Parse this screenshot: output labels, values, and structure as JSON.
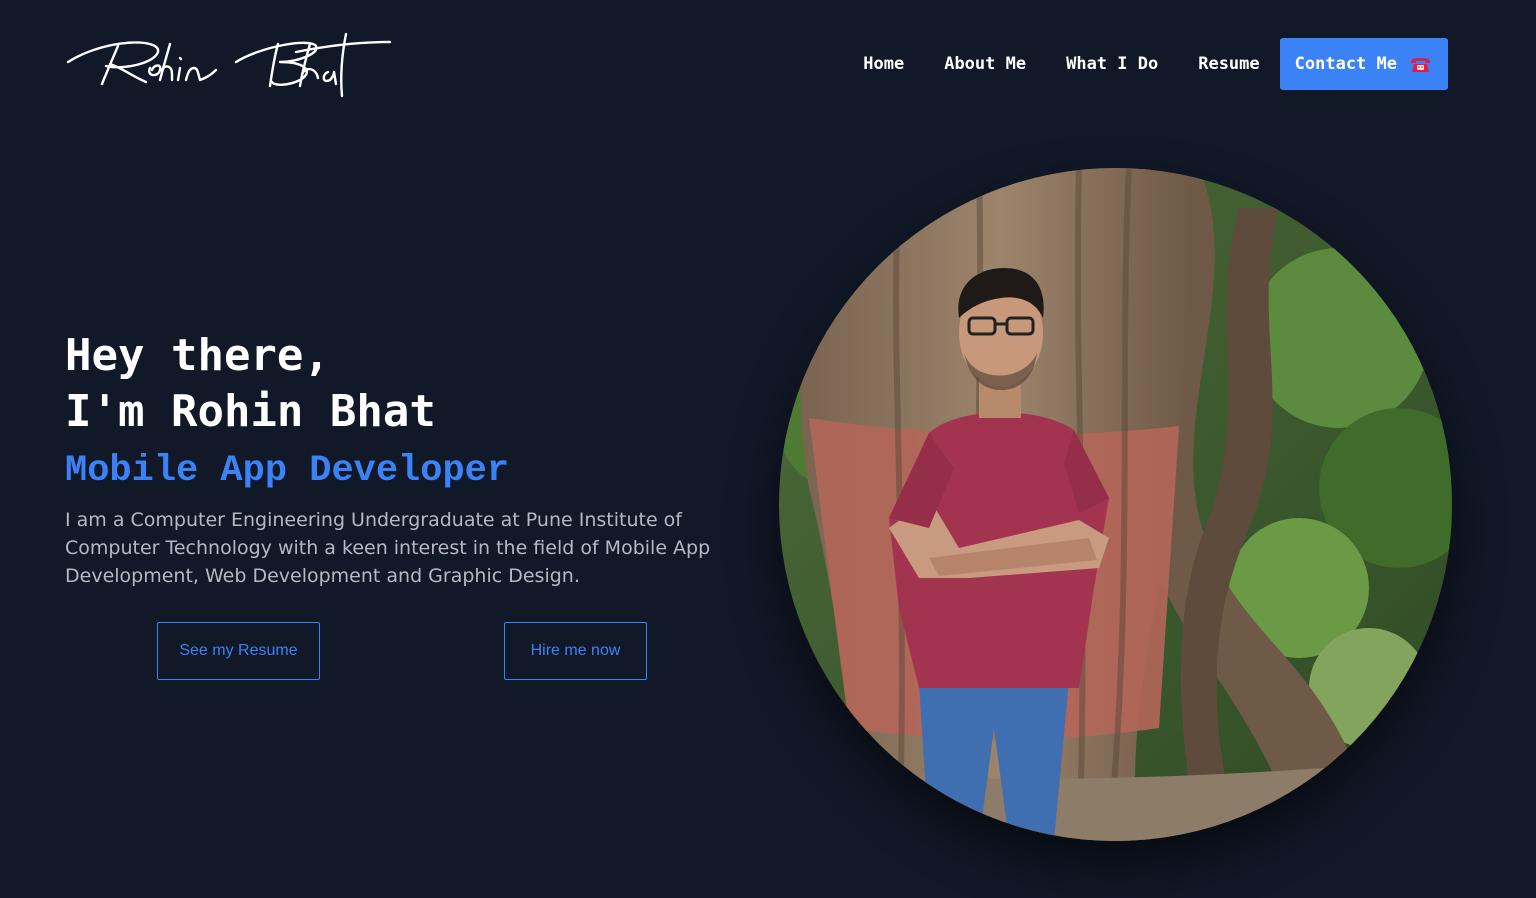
{
  "brand": {
    "logo_text": "Rohin Bhat"
  },
  "nav": {
    "items": [
      {
        "label": "Home"
      },
      {
        "label": "About Me"
      },
      {
        "label": "What I Do"
      },
      {
        "label": "Resume"
      }
    ],
    "contact": {
      "label": "Contact Me",
      "icon": "telephone-icon",
      "background": "#3b82f6"
    }
  },
  "hero": {
    "greeting_line1": "Hey there,",
    "greeting_line2": "I'm Rohin Bhat",
    "role": "Mobile App Developer",
    "description": "I am a Computer Engineering Undergraduate at Pune Institute of Computer Technology with a keen interest in the field of Mobile App Development, Web Development and Graphic Design.",
    "buttons": {
      "resume": "See my Resume",
      "hire": "Hire me now"
    },
    "profile_photo": {
      "subject": "man in maroon t-shirt with crossed arms leaning on a tree trunk"
    }
  },
  "theme": {
    "background": "#111827",
    "accent": "#3b82f6",
    "text": "#ffffff",
    "muted_text": "#b6b9c2"
  }
}
